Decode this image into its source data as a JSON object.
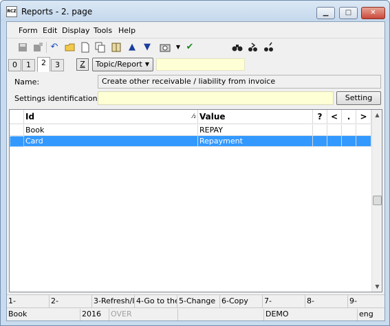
{
  "window": {
    "title": "Reports - 2. page",
    "app_icon_text": "RCZ",
    "minimize": "▁",
    "maximize": "□",
    "close": "✕"
  },
  "menu": [
    "Form",
    "Edit",
    "Display",
    "Tools",
    "Help"
  ],
  "toolbar": {
    "icons": [
      "save-icon",
      "save-as-icon",
      "undo-icon",
      "open-folder-icon",
      "new-document-icon",
      "copy-icon",
      "book-icon",
      "arrow-up-icon",
      "arrow-down-icon",
      "camera-icon",
      "dropdown-arrow-icon",
      "filter-check-icon",
      "binoculars-icon",
      "find-next-icon",
      "find-replace-icon"
    ]
  },
  "tabs": [
    "0",
    "1",
    "2",
    "3"
  ],
  "active_tab": "2",
  "z_button": "Z",
  "topic_combo": "Topic/Report",
  "form": {
    "name_label": "Name:",
    "name_value": "Create other receivable / liability from invoice",
    "settings_label": "Settings identification:",
    "settings_value": "",
    "setting_button": "Setting"
  },
  "grid": {
    "columns": {
      "id": "Id",
      "sort_marker": "⁄₂",
      "value": "Value",
      "q": "?",
      "lt": "<",
      "dot": ".",
      "gt": ">"
    },
    "rows": [
      {
        "id": "Book",
        "value": "REPAY",
        "selected": false
      },
      {
        "id": "Card",
        "value": "Repayment",
        "selected": true
      }
    ]
  },
  "function_keys": [
    "1-",
    "2-",
    "3-Refresh/I",
    "4-Go to the",
    "5-Change",
    "6-Copy",
    "7-",
    "8-",
    "9-"
  ],
  "status": {
    "book": "Book",
    "year": "2016",
    "mode": "OVER",
    "company": "DEMO",
    "language": "eng"
  },
  "colors": {
    "selection": "#3399ff",
    "input_yellow": "#ffffd5",
    "frame": "#c9dcef"
  }
}
